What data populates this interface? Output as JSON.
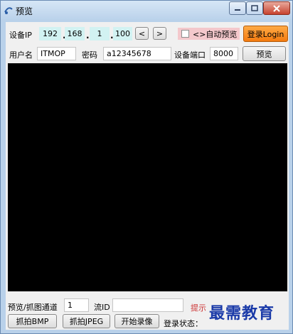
{
  "window": {
    "title": "预览"
  },
  "row1": {
    "device_ip_label": "设备IP",
    "ip": [
      "192",
      "168",
      "1",
      "100"
    ],
    "prev_label": "<",
    "next_label": ">",
    "auto_preview_label": "<>自动预览",
    "login_label": "登录Login"
  },
  "row2": {
    "username_label": "用户名",
    "username_value": "ITMOP",
    "password_label": "密码",
    "password_value": "a12345678",
    "port_label": "设备端口",
    "port_value": "8000",
    "preview_label": "预览"
  },
  "bottom": {
    "channel_label": "预览/抓图通道",
    "channel_value": "1",
    "stream_label": "流ID",
    "stream_value": "",
    "hint_label": "提示",
    "bmp_label": "抓拍BMP",
    "jpeg_label": "抓拍JPEG",
    "record_label": "开始录像",
    "login_status_label": "登录状态："
  },
  "watermark": "最需教育",
  "colors": {
    "login_button": "#f47b0f",
    "ip_field": "#d2f2f2",
    "video_bg": "#000000",
    "close_button": "#c7432f"
  }
}
